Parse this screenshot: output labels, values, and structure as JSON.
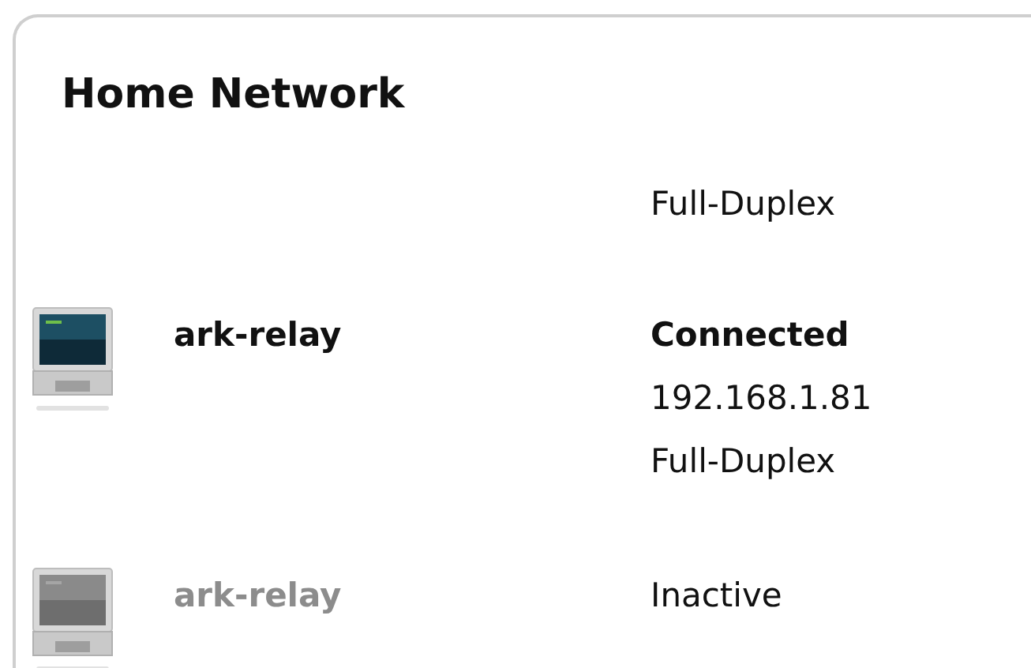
{
  "title": "Home Network",
  "partial_row": {
    "details": [
      "Full-Duplex"
    ]
  },
  "devices": [
    {
      "name": "ark-relay",
      "active": true,
      "status": "Connected",
      "details": [
        "192.168.1.81",
        "Full-Duplex"
      ]
    },
    {
      "name": "ark-relay",
      "active": false,
      "status": "Inactive"
    }
  ]
}
